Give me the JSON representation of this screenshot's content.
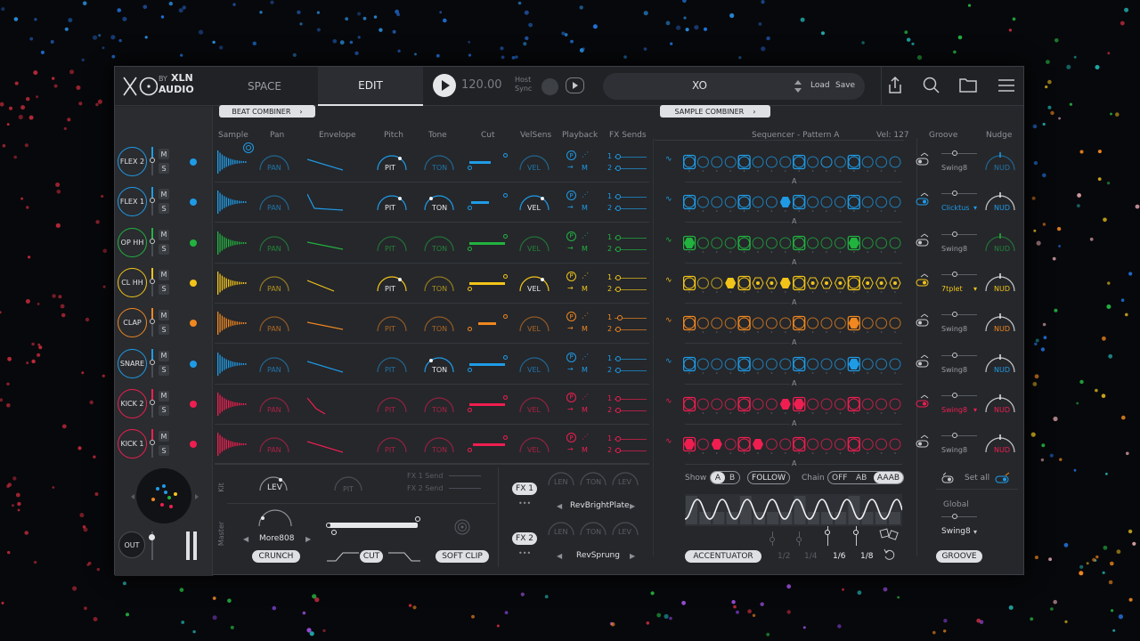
{
  "app": {
    "logo": "XO",
    "brand_by": "BY",
    "brand_xln": "XLN",
    "brand_audio": "AUDIO"
  },
  "header": {
    "tab_space": "SPACE",
    "tab_edit": "EDIT",
    "tempo": "120.00",
    "host_sync": "Host",
    "host_sync_2": "Sync",
    "preset_name": "XO",
    "load": "Load",
    "save": "Save"
  },
  "combiners": {
    "beat": "BEAT COMBINER",
    "sample": "SAMPLE COMBINER"
  },
  "columns": {
    "sample": "Sample",
    "pan": "Pan",
    "envelope": "Envelope",
    "pitch": "Pitch",
    "tone": "Tone",
    "cut": "Cut",
    "velsens": "VelSens",
    "playback": "Playback",
    "fx_sends": "FX Sends",
    "sequencer": "Sequencer - Pattern A",
    "vel": "Vel: 127",
    "groove": "Groove",
    "nudge": "Nudge"
  },
  "knob_labels": {
    "pan": "PAN",
    "pit": "PIT",
    "ton": "TON",
    "vel": "VEL",
    "nud": "NUD",
    "lev": "LEV",
    "len": "LEN",
    "p": "P",
    "m": "M",
    "one": "1",
    "two": "2",
    "a": "A"
  },
  "colors": {
    "blue": "#1f9be6",
    "green": "#22b33f",
    "yellow": "#f2c419",
    "orange": "#f0871f",
    "red": "#f01e50",
    "pink": "#e8467f"
  },
  "channels": [
    {
      "name": "FLEX 2",
      "color": "#1f9be6",
      "groove": "Swing8",
      "groove_active": false,
      "nud_active": false
    },
    {
      "name": "FLEX 1",
      "color": "#1f9be6",
      "groove": "Clicktus",
      "groove_active": true,
      "nud_active": true
    },
    {
      "name": "OP HH",
      "color": "#22b33f",
      "groove": "Swing8",
      "groove_active": false,
      "nud_active": false
    },
    {
      "name": "CL HH",
      "color": "#f2c419",
      "groove": "7tplet",
      "groove_active": true,
      "nud_active": true
    },
    {
      "name": "CLAP",
      "color": "#f0871f",
      "groove": "Swing8",
      "groove_active": false,
      "nud_active": true
    },
    {
      "name": "SNARE",
      "color": "#1f9be6",
      "groove": "Swing8",
      "groove_active": false,
      "nud_active": true
    },
    {
      "name": "KICK 2",
      "color": "#f01e50",
      "groove": "Swing8",
      "groove_active": true,
      "nud_active": true
    },
    {
      "name": "KICK 1",
      "color": "#f01e50",
      "groove": "Swing8",
      "groove_active": false,
      "nud_active": true
    }
  ],
  "mute_label": "M",
  "solo_label": "S",
  "out_label": "OUT",
  "kit": {
    "section": "Kit",
    "fx1_send": "FX 1 Send",
    "fx2_send": "FX 2 Send"
  },
  "master": {
    "section": "Master",
    "preset": "More808",
    "crunch": "CRUNCH",
    "cut": "CUT",
    "soft_clip": "SOFT CLIP"
  },
  "fx": {
    "fx1": "FX 1",
    "fx1_preset": "RevBrightPlate",
    "fx2": "FX 2",
    "fx2_preset": "RevSprung"
  },
  "sequencer_footer": {
    "show": "Show",
    "a": "A",
    "b": "B",
    "follow": "FOLLOW",
    "chain": "Chain",
    "off": "OFF",
    "ab": "AB",
    "aaab": "AAAB",
    "accentuator": "ACCENTUATOR",
    "r12": "1/2",
    "r14": "1/4",
    "r16": "1/6",
    "r18": "1/8"
  },
  "groove_footer": {
    "set_all": "Set all",
    "global": "Global",
    "global_value": "Swing8",
    "groove_button": "GROOVE"
  }
}
